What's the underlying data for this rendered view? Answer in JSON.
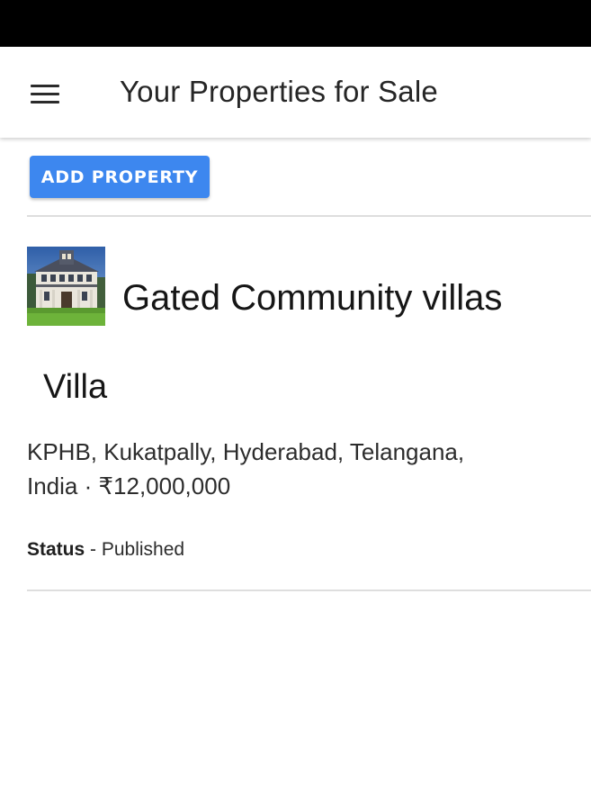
{
  "app_bar": {
    "title": "Your Properties for Sale",
    "menu_icon": "hamburger-menu-icon"
  },
  "actions": {
    "add_property_label": "ADD PROPERTY"
  },
  "colors": {
    "primary_button": "#3d87ef",
    "status_bar": "#000000"
  },
  "properties": [
    {
      "thumbnail": "house-thumbnail-image",
      "name": "Gated Community villas",
      "type": "Villa",
      "address_line1": "KPHB, Kukatpally, Hyderabad, Telangana,",
      "address_line2": "India · ₹12,000,000",
      "status_label": "Status",
      "status_separator": " - ",
      "status_value": "Published"
    }
  ]
}
